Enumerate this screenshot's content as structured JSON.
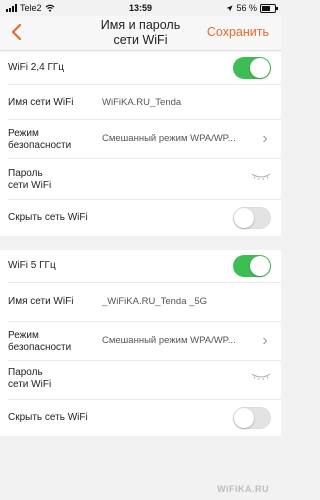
{
  "status": {
    "carrier": "Tele2",
    "time": "13:59",
    "battery": "56 %"
  },
  "nav": {
    "title_line1": "Имя и пароль",
    "title_line2": "сети WiFi",
    "save_label": "Сохранить",
    "back_icon": "chevron-left-icon",
    "accent": "#e8692c"
  },
  "wifi24": {
    "toggle_label": "WiFi 2,4 ГГц",
    "enabled": true,
    "name_label": "Имя сети WiFi",
    "name_value": "WiFiKA.RU_Tenda",
    "security_label_line1": "Режим",
    "security_label_line2": "безопасности",
    "security_value": "Смешанный режим WPA/WP...",
    "password_label_line1": "Пароль",
    "password_label_line2": "сети WiFi",
    "hide_label": "Скрыть сеть WiFi",
    "hidden": false
  },
  "wifi5": {
    "toggle_label": "WiFi 5 ГГц",
    "enabled": true,
    "name_label": "Имя сети WiFi",
    "name_value": "_WiFiKA.RU_Tenda _5G",
    "security_label_line1": "Режим",
    "security_label_line2": "безопасности",
    "security_value": "Смешанный режим WPA/WP...",
    "password_label_line1": "Пароль",
    "password_label_line2": "сети WiFi",
    "hide_label": "Скрыть сеть WiFi",
    "hidden": false
  },
  "colors": {
    "toggle_on": "#3dbe55",
    "toggle_off": "#e3e3e3"
  },
  "watermark": "WiFiKA.RU"
}
